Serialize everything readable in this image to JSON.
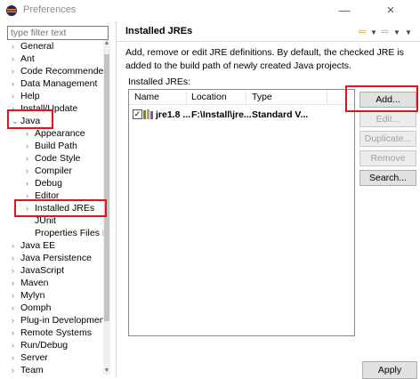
{
  "window": {
    "title": "Preferences",
    "minimize_glyph": "—",
    "close_glyph": "×"
  },
  "filter": {
    "placeholder": "type filter text"
  },
  "tree": [
    {
      "label": "General",
      "expanded": false
    },
    {
      "label": "Ant",
      "expanded": false
    },
    {
      "label": "Code Recommenders",
      "expanded": false
    },
    {
      "label": "Data Management",
      "expanded": false
    },
    {
      "label": "Help",
      "expanded": false
    },
    {
      "label": "Install/Update",
      "expanded": false
    },
    {
      "label": "Java",
      "expanded": true
    },
    {
      "label": "Appearance",
      "expanded": false
    },
    {
      "label": "Build Path",
      "expanded": false
    },
    {
      "label": "Code Style",
      "expanded": false
    },
    {
      "label": "Compiler",
      "expanded": false
    },
    {
      "label": "Debug",
      "expanded": false
    },
    {
      "label": "Editor",
      "expanded": false
    },
    {
      "label": "Installed JREs",
      "expanded": false
    },
    {
      "label": "JUnit",
      "expanded": false
    },
    {
      "label": "Properties Files Ed",
      "expanded": false
    },
    {
      "label": "Java EE",
      "expanded": false
    },
    {
      "label": "Java Persistence",
      "expanded": false
    },
    {
      "label": "JavaScript",
      "expanded": false
    },
    {
      "label": "Maven",
      "expanded": false
    },
    {
      "label": "Mylyn",
      "expanded": false
    },
    {
      "label": "Oomph",
      "expanded": false
    },
    {
      "label": "Plug-in Development",
      "expanded": false
    },
    {
      "label": "Remote Systems",
      "expanded": false
    },
    {
      "label": "Run/Debug",
      "expanded": false
    },
    {
      "label": "Server",
      "expanded": false
    },
    {
      "label": "Team",
      "expanded": false
    }
  ],
  "page": {
    "title": "Installed JREs",
    "description": "Add, remove or edit JRE definitions. By default, the checked JRE is added to the build path of newly created Java projects.",
    "jres_label": "Installed JREs:",
    "columns": {
      "name": "Name",
      "location": "Location",
      "type": "Type"
    },
    "rows": [
      {
        "checked": true,
        "name": "jre1.8 ...",
        "location": "F:\\Install\\jre...",
        "type": "Standard V..."
      }
    ]
  },
  "buttons": {
    "add": "Add...",
    "edit": "Edit...",
    "duplicate": "Duplicate...",
    "remove": "Remove",
    "search": "Search...",
    "apply": "Apply"
  },
  "colors": {
    "annotation": "#e0141e",
    "nav_back": "#e89a1f"
  }
}
